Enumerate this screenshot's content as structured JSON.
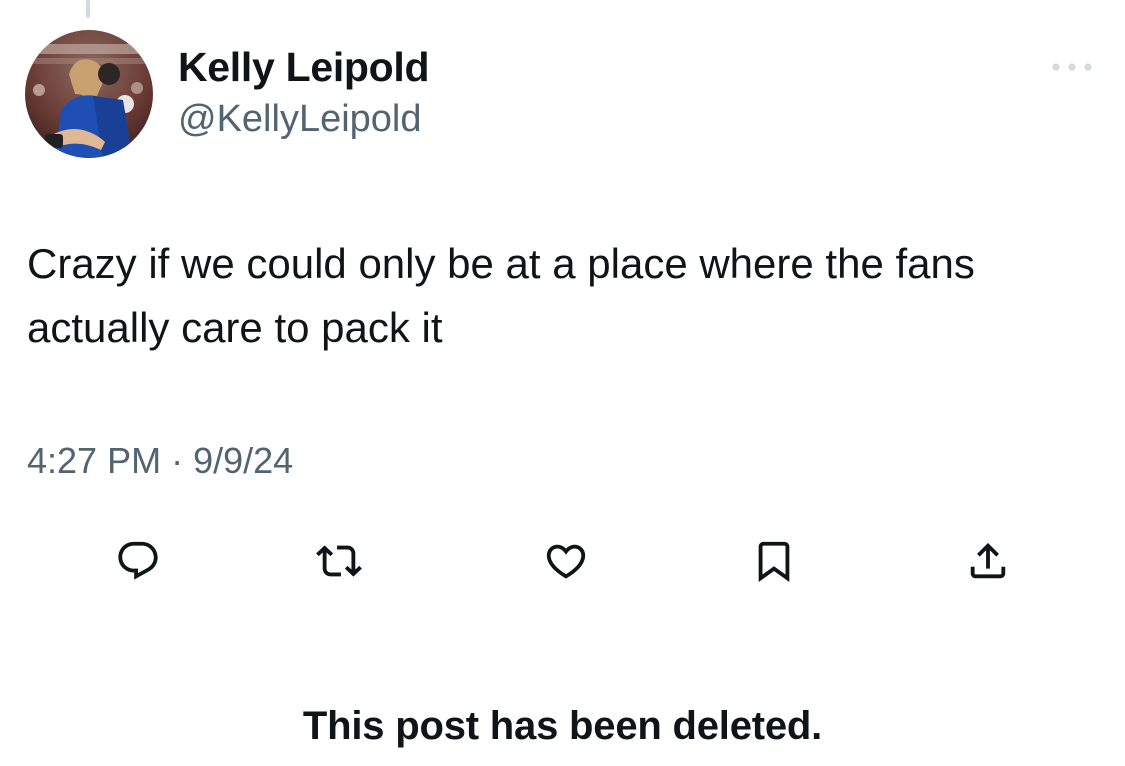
{
  "author": {
    "display_name": "Kelly Leipold",
    "handle": "@KellyLeipold",
    "avatar_icon": "profile-photo"
  },
  "post": {
    "text": "Crazy if we could only be at a place where the fans actually care to pack it",
    "time": "4:27 PM",
    "separator": "·",
    "date": "9/9/24"
  },
  "actions": [
    {
      "icon": "reply-icon"
    },
    {
      "icon": "repost-icon"
    },
    {
      "icon": "like-icon"
    },
    {
      "icon": "bookmark-icon"
    },
    {
      "icon": "share-icon"
    }
  ],
  "more_icon": "more-icon",
  "notice": "This post has been deleted.",
  "colors": {
    "text": "#0f1419",
    "secondary": "#536471",
    "thread_line": "#cfd9de"
  }
}
